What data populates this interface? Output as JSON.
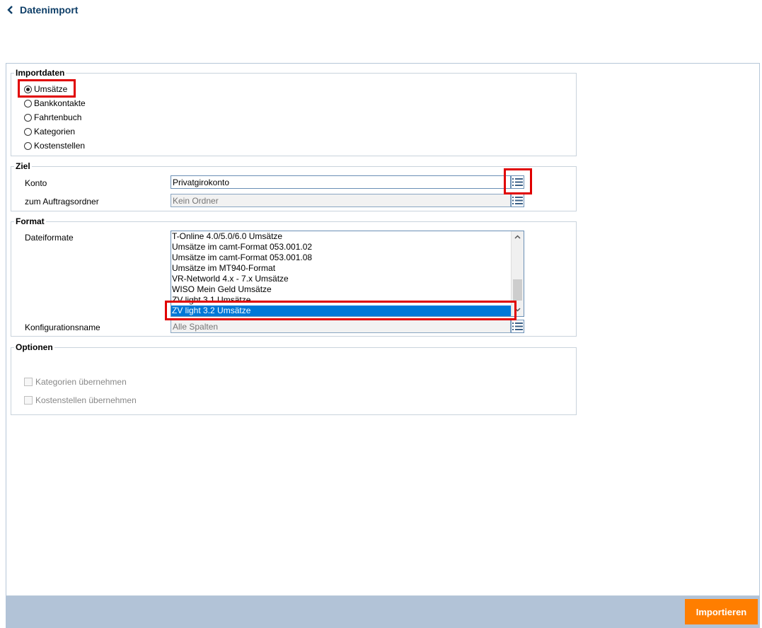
{
  "header": {
    "title": "Datenimport"
  },
  "importdaten": {
    "title": "Importdaten",
    "options": [
      "Umsätze",
      "Bankkontakte",
      "Fahrtenbuch",
      "Kategorien",
      "Kostenstellen"
    ],
    "selected": "Umsätze"
  },
  "ziel": {
    "title": "Ziel",
    "konto_label": "Konto",
    "konto_value": "Privatgirokonto",
    "ordner_label": "zum Auftragsordner",
    "ordner_placeholder": "Kein Ordner"
  },
  "format": {
    "title": "Format",
    "dateiformate_label": "Dateiformate",
    "items": [
      "T-Online 4.0/5.0/6.0 Umsätze",
      "Umsätze im camt-Format 053.001.02",
      "Umsätze im camt-Format 053.001.08",
      "Umsätze im MT940-Format",
      "VR-Networld 4.x - 7.x Umsätze",
      "WISO Mein Geld Umsätze",
      "ZV light 3.1 Umsätze",
      "ZV light 3.2 Umsätze"
    ],
    "selected_item": "ZV light 3.2 Umsätze",
    "konfig_label": "Konfigurationsname",
    "konfig_placeholder": "Alle Spalten"
  },
  "optionen": {
    "title": "Optionen",
    "kategorien_label": "Kategorien übernehmen",
    "kostenstellen_label": "Kostenstellen übernehmen"
  },
  "footer": {
    "import_label": "Importieren"
  },
  "colors": {
    "accent": "#ff7e00",
    "selection": "#0078d7",
    "highlight": "#e00000",
    "footer_bar": "#b2c3d7"
  }
}
